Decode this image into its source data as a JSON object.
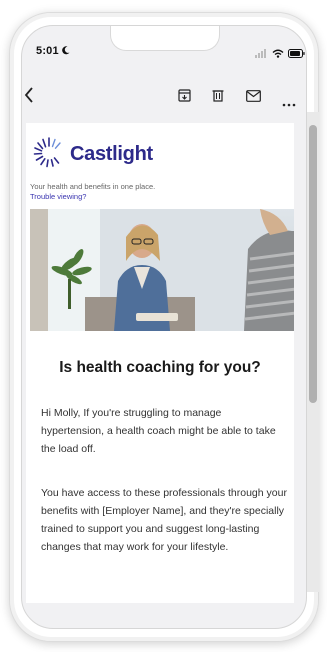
{
  "status_bar": {
    "time": "5:01"
  },
  "toolbar": {
    "back_icon": "chevron-left-icon",
    "actions": [
      "archive-icon",
      "trash-icon",
      "mail-icon",
      "more-icon"
    ]
  },
  "email": {
    "brand_name": "Castlight",
    "tagline": "Your health and benefits in one place.",
    "trouble_link": "Trouble viewing?",
    "headline": "Is health coaching for you?",
    "paragraph_1": "Hi Molly, If you're struggling to manage hypertension, a health coach might be able to take the load off.",
    "paragraph_2": "You have access to these professionals through your benefits with [Employer Name], and they're specially trained to support you and suggest long-lasting changes that may work for your lifestyle."
  },
  "colors": {
    "brand": "#2d2a8a",
    "link": "#3a35b0",
    "screen_bg": "#f1f1f3"
  }
}
